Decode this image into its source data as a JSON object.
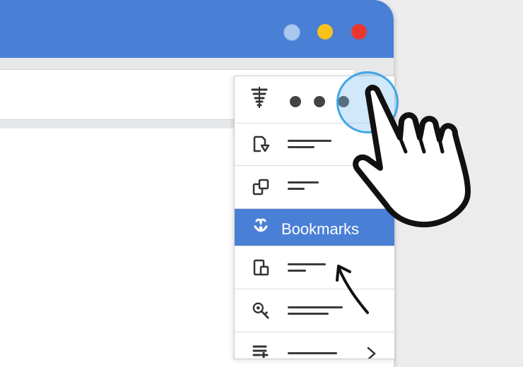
{
  "window": {
    "title_bar": {
      "accent_color": "#4a7fd6"
    },
    "controls": [
      {
        "name": "minimize",
        "color": "#a9c8f0"
      },
      {
        "name": "maximize",
        "color": "#f6c21b"
      },
      {
        "name": "close",
        "color": "#e9372f"
      }
    ]
  },
  "menu": {
    "header_icon": "tornado-icon",
    "more_button_icon": "more-dots-icon",
    "items": [
      {
        "icon": "save-page-icon",
        "label": ""
      },
      {
        "icon": "copy-icon",
        "label": ""
      },
      {
        "icon": "bookmark-heart-icon",
        "label": "Bookmarks",
        "selected": true
      },
      {
        "icon": "device-icon",
        "label": ""
      },
      {
        "icon": "search-key-icon",
        "label": ""
      },
      {
        "icon": "list-icon",
        "label": ""
      }
    ]
  },
  "overlay": {
    "pointer": "hand-cursor-icon",
    "annotation": "curved-arrow-icon"
  }
}
